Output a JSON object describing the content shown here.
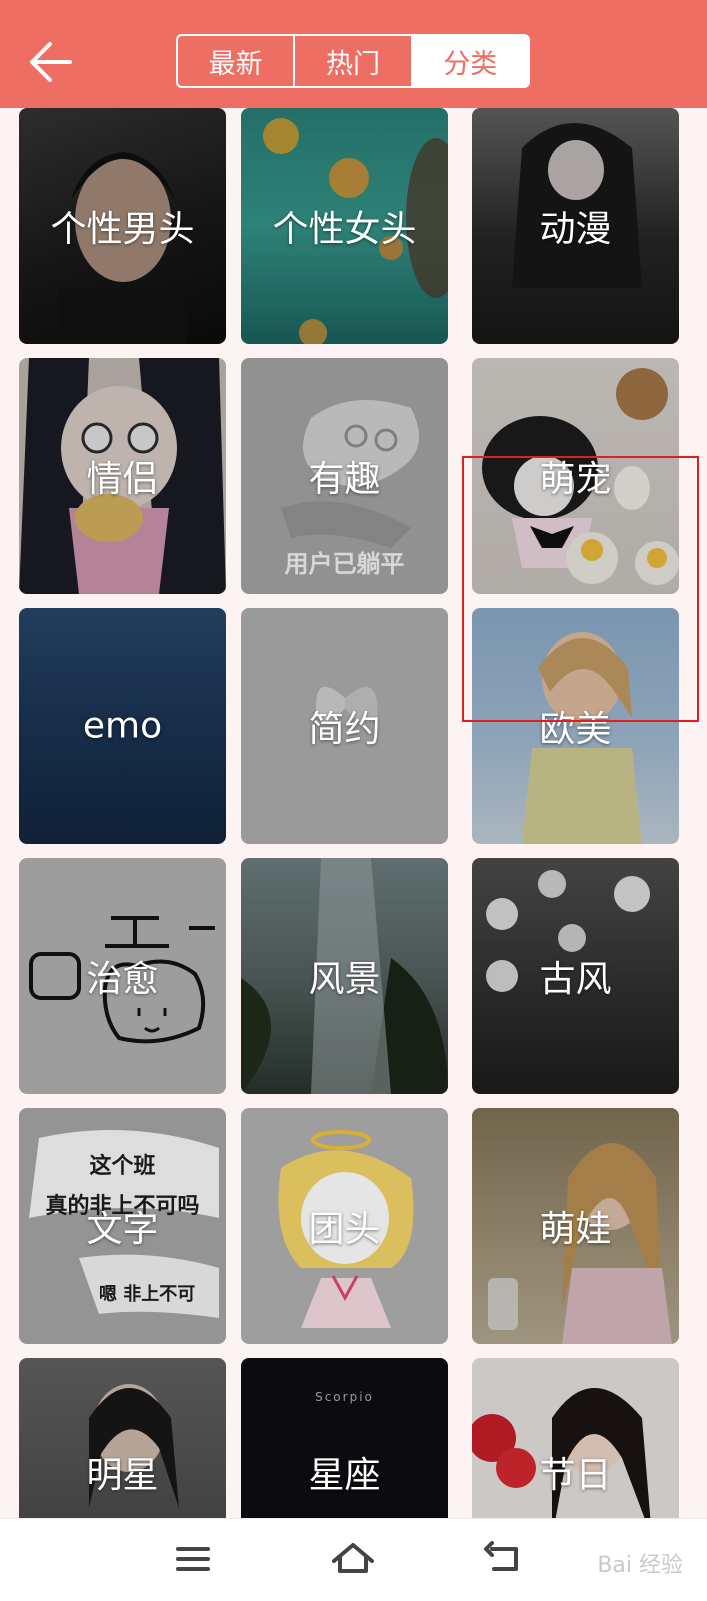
{
  "header": {
    "back_icon": "arrow-left-icon",
    "tabs": [
      {
        "label": "最新",
        "active": false
      },
      {
        "label": "热门",
        "active": false
      },
      {
        "label": "分类",
        "active": true
      }
    ],
    "accent_color": "#ef6e63"
  },
  "categories": [
    {
      "label": "个性男头"
    },
    {
      "label": "个性女头"
    },
    {
      "label": "动漫"
    },
    {
      "label": "情侣"
    },
    {
      "label": "有趣",
      "image_caption": "用户已躺平"
    },
    {
      "label": "萌宠"
    },
    {
      "label": "emo"
    },
    {
      "label": "简约"
    },
    {
      "label": "欧美"
    },
    {
      "label": "治愈"
    },
    {
      "label": "风景"
    },
    {
      "label": "古风"
    },
    {
      "label": "文字",
      "image_caption_line1": "这个班",
      "image_caption_line2": "真的非上不可吗",
      "image_caption_line3": "嗯 非上不可"
    },
    {
      "label": "团头"
    },
    {
      "label": "萌娃"
    },
    {
      "label": "明星"
    },
    {
      "label": "星座",
      "image_caption": "Scorpio"
    },
    {
      "label": "节日"
    }
  ],
  "navbar": {
    "menu_icon": "menu-icon",
    "home_icon": "home-icon",
    "back_icon": "return-icon",
    "watermark": "Bai 经验"
  }
}
